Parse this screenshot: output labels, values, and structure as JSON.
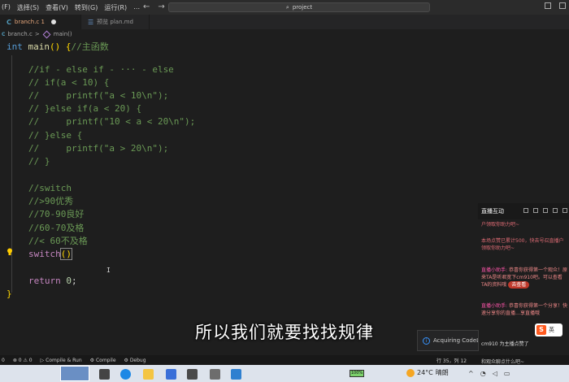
{
  "menu": [
    "(F)",
    "选择(S)",
    "查看(V)",
    "转到(G)",
    "运行(R)",
    "…"
  ],
  "search": {
    "icon": "search-icon",
    "label": "project"
  },
  "tabs": [
    {
      "label": "branch.c 1",
      "icon": "C",
      "active": true,
      "modified": true
    },
    {
      "label": "预览 plan.md",
      "icon": "md-icon",
      "active": false
    }
  ],
  "breadcrumb": {
    "file": "branch.c",
    "separator": ">",
    "symbol": "main()"
  },
  "code": {
    "l1_kw": "int",
    "l1_fn": "main",
    "l1_paren": "()",
    "l1_brace": "{",
    "l1_comment": "//主函数",
    "c1": "//if - else if - ··· - else",
    "c2": "// if(a < 10) {",
    "c3": "//     printf(\"a < 10\\n\");",
    "c4": "// }else if(a < 20) {",
    "c5": "//     printf(\"10 < a < 20\\n\");",
    "c6": "// }else {",
    "c7": "//     printf(\"a > 20\\n\");",
    "c8": "// }",
    "c9": "//switch",
    "c10": "//>90优秀",
    "c11": "//70-90良好",
    "c12": "//60-70及格",
    "c13": "//< 60不及格",
    "sw_kw": "switch",
    "sw_paren": "()",
    "ret_kw": "return",
    "ret_val": "0",
    "ret_semi": ";",
    "close_brace": "}"
  },
  "live": {
    "title": "直播互动",
    "messages": [
      {
        "text": "户领取你助力吧~"
      },
      {
        "text": "本场点赞已累计500，快去号召直播户领取你助力吧~"
      },
      {
        "who": "直播小助手:",
        "text": "恭喜你获得第一个观众！原来TA是听君宽下cm910吧。可以查看TA的资料哦",
        "badge": "去查看"
      },
      {
        "who": "直播小助手:",
        "text": "恭喜你获得第一个分享！快速分享你的直播…享直播哦"
      }
    ],
    "reply": "cm910 为主播点赞了"
  },
  "subtitle": "所以我们就要找找规律",
  "notification": "Acquiring CodeLL",
  "status": {
    "left": [
      "0",
      "⊗ 0 ⚠ 0",
      "Compile & Run",
      "Compile",
      "Debug"
    ],
    "position": "行 35，列 12",
    "message": "和观众聊点什么吧~"
  },
  "taskbar": {
    "battery": "100%",
    "temperature": "24°C",
    "weather": "晴朗"
  },
  "ime": {
    "label": "英"
  }
}
